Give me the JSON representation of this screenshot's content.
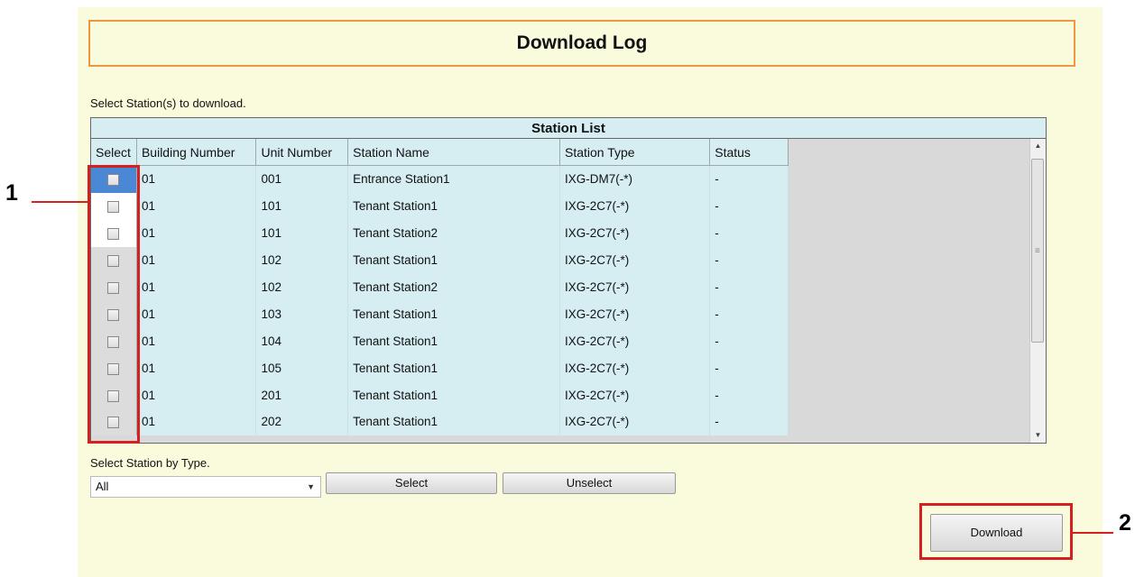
{
  "page": {
    "title": "Download Log"
  },
  "instructions": {
    "select_stations": "Select Station(s) to download.",
    "select_by_type": "Select Station by Type."
  },
  "station_list": {
    "title": "Station List",
    "columns": [
      "Select",
      "Building Number",
      "Unit Number",
      "Station Name",
      "Station Type",
      "Status"
    ],
    "rows": [
      {
        "building": "01",
        "unit": "001",
        "name": "Entrance Station1",
        "type": "IXG-DM7(-*)",
        "status": "-"
      },
      {
        "building": "01",
        "unit": "101",
        "name": "Tenant Station1",
        "type": "IXG-2C7(-*)",
        "status": "-"
      },
      {
        "building": "01",
        "unit": "101",
        "name": "Tenant Station2",
        "type": "IXG-2C7(-*)",
        "status": "-"
      },
      {
        "building": "01",
        "unit": "102",
        "name": "Tenant Station1",
        "type": "IXG-2C7(-*)",
        "status": "-"
      },
      {
        "building": "01",
        "unit": "102",
        "name": "Tenant Station2",
        "type": "IXG-2C7(-*)",
        "status": "-"
      },
      {
        "building": "01",
        "unit": "103",
        "name": "Tenant Station1",
        "type": "IXG-2C7(-*)",
        "status": "-"
      },
      {
        "building": "01",
        "unit": "104",
        "name": "Tenant Station1",
        "type": "IXG-2C7(-*)",
        "status": "-"
      },
      {
        "building": "01",
        "unit": "105",
        "name": "Tenant Station1",
        "type": "IXG-2C7(-*)",
        "status": "-"
      },
      {
        "building": "01",
        "unit": "201",
        "name": "Tenant Station1",
        "type": "IXG-2C7(-*)",
        "status": "-"
      },
      {
        "building": "01",
        "unit": "202",
        "name": "Tenant Station1",
        "type": "IXG-2C7(-*)",
        "status": "-"
      }
    ]
  },
  "type_dropdown": {
    "value": "All"
  },
  "buttons": {
    "select": "Select",
    "unselect": "Unselect",
    "download": "Download"
  },
  "callouts": [
    "1",
    "2"
  ],
  "colors": {
    "annotation": "#d42020",
    "title_border": "#f0963c",
    "panel_bg": "#fafadc",
    "table_bg": "#d6eef2"
  }
}
